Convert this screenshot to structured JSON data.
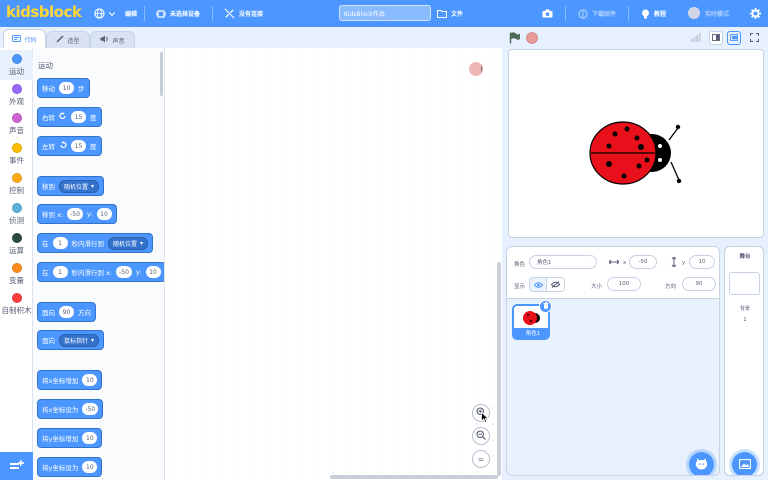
{
  "app": {
    "logo": "kidsblock"
  },
  "menu": {
    "edit": "编辑",
    "device": "未选择设备",
    "connection": "没有连接",
    "project_title": "KidsBlock作品",
    "file": "文件",
    "download_firmware": "下载固件",
    "tutorial": "教程",
    "realtime_mode": "实时模式"
  },
  "tabs": [
    {
      "label": "代码",
      "icon": "code-icon"
    },
    {
      "label": "造型",
      "icon": "brush-icon"
    },
    {
      "label": "声音",
      "icon": "speaker-icon"
    }
  ],
  "categories": [
    {
      "label": "运动",
      "color": "#4c97ff"
    },
    {
      "label": "外观",
      "color": "#9966ff"
    },
    {
      "label": "声音",
      "color": "#cf63cf"
    },
    {
      "label": "事件",
      "color": "#ffbf00"
    },
    {
      "label": "控制",
      "color": "#ffab19"
    },
    {
      "label": "侦测",
      "color": "#5cb1d6"
    },
    {
      "label": "运算",
      "color": "#2e4a40"
    },
    {
      "label": "变量",
      "color": "#ff8c1a"
    },
    {
      "label": "自制积木",
      "color": "#ff3f3f"
    }
  ],
  "palette": {
    "heading": "运动",
    "move": {
      "label": "移动",
      "value": "10",
      "suffix": "步"
    },
    "turn_right": {
      "label": "右转",
      "value": "15",
      "suffix": "度"
    },
    "turn_left": {
      "label": "左转",
      "value": "15",
      "suffix": "度"
    },
    "goto": {
      "label": "移到",
      "option": "随机位置"
    },
    "goto_xy": {
      "label": "移到 x:",
      "x": "-50",
      "ylabel": "y:",
      "y": "10"
    },
    "glide": {
      "label": "在",
      "secs": "1",
      "mid": "秒内滑行到",
      "option": "随机位置"
    },
    "glide_xy": {
      "label": "在",
      "secs": "1",
      "mid": "秒内滑行到 x:",
      "x": "-50",
      "ylabel": "y:",
      "y": "10"
    },
    "point": {
      "label": "面向",
      "value": "90",
      "suffix": "方向"
    },
    "point_towards": {
      "label": "面向",
      "option": "鼠标指针"
    },
    "change_x": {
      "label": "将x坐标增加",
      "value": "10"
    },
    "set_x": {
      "label": "将x坐标设为",
      "value": "-50"
    },
    "change_y": {
      "label": "将y坐标增加",
      "value": "10"
    },
    "set_y": {
      "label": "将y坐标设为",
      "value": "10"
    }
  },
  "workspace": {
    "zoom_reset": "="
  },
  "sprite_info": {
    "sprite_label": "角色",
    "sprite_name": "角色1",
    "x_label": "x",
    "x_value": "-50",
    "y_label": "y",
    "y_value": "10",
    "show_label": "显示",
    "size_label": "大小",
    "size_value": "100",
    "direction_label": "方向",
    "direction_value": "90"
  },
  "sprites": [
    {
      "name": "角色1"
    }
  ],
  "stage_panel": {
    "title": "舞台",
    "backdrop_label": "背景",
    "backdrop_count": "1"
  },
  "colors": {
    "accent": "#4c97ff",
    "motion": "#4c97ff",
    "logo": "#ffd43b",
    "workspace": "#ffffff",
    "panel": "#e9f1fc"
  }
}
